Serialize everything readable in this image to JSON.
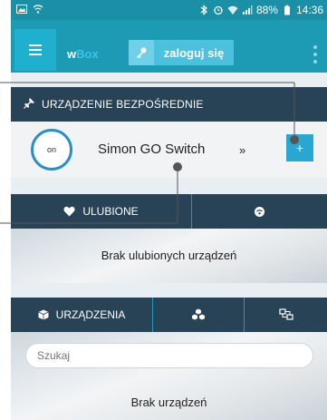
{
  "status_bar": {
    "time": "14:36",
    "battery": "88%"
  },
  "app_bar": {
    "brand_part1": "w",
    "brand_part2": "Box",
    "login_label": "zaloguj się"
  },
  "direct_device": {
    "header": "URZĄDZENIE BEZPOŚREDNIE",
    "state": "on",
    "name": "Simon GO Switch",
    "arrow": "»",
    "add_label": "+"
  },
  "favorites_tabs": [
    {
      "label": "ULUBIONE",
      "icon": "heart-icon"
    },
    {
      "label": "",
      "icon": "wifi-icon"
    }
  ],
  "favorites_empty": "Brak ulubionych urządzeń",
  "devices_tabs": [
    {
      "label": "URZĄDZENIA",
      "icon": "cube-icon"
    },
    {
      "label": "",
      "icon": "cubes-icon"
    },
    {
      "label": "",
      "icon": "network-icon"
    }
  ],
  "search": {
    "placeholder": "Szukaj"
  },
  "devices_empty": "Brak urządzeń",
  "colors": {
    "status_bar": "#1b8fa6",
    "app_bar": "#1e9bb4",
    "dark_section": "#284355",
    "accent": "#2aa6d2"
  }
}
